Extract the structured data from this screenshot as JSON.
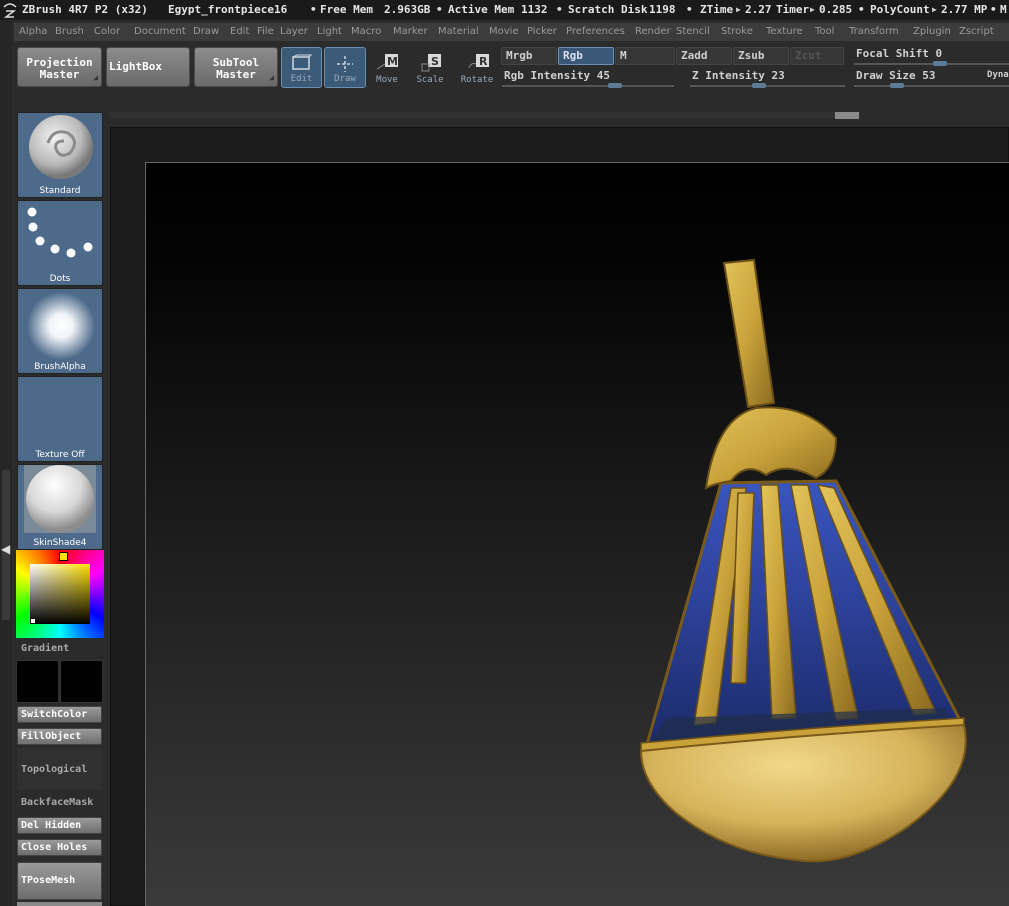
{
  "titlebar": {
    "app": "ZBrush 4R7 P2 (x32)",
    "document": "Egypt_frontpiece16",
    "free_mem_label": "Free Mem",
    "free_mem_value": "2.963GB",
    "active_mem_label": "Active Mem",
    "active_mem_value": "1132",
    "scratch_label": "Scratch Disk",
    "scratch_value": "1198",
    "ztime_label": "ZTime",
    "ztime_value": "2.27",
    "timer_label": "Timer",
    "timer_value": "0.285",
    "polycount_label": "PolyCount",
    "polycount_value": "2.77 MP",
    "trailing": "M"
  },
  "menubar": [
    "Alpha",
    "Brush",
    "Color",
    "Document",
    "Draw",
    "Edit",
    "File",
    "Layer",
    "Light",
    "Macro",
    "Marker",
    "Material",
    "Movie",
    "Picker",
    "Preferences",
    "Render",
    "Stencil",
    "Stroke",
    "Texture",
    "Tool",
    "Transform",
    "Zplugin",
    "Zscript"
  ],
  "toolbar": {
    "projection_master": [
      "Projection",
      "Master"
    ],
    "lightbox": "LightBox",
    "subtool_master": [
      "SubTool",
      "Master"
    ],
    "edit": "Edit",
    "draw": "Draw",
    "move": "Move",
    "scale": "Scale",
    "rotate": "Rotate",
    "mrgb": "Mrgb",
    "rgb": "Rgb",
    "m": "M",
    "zadd": "Zadd",
    "zsub": "Zsub",
    "zcut": "Zcut",
    "rgb_intensity_label": "Rgb Intensity",
    "rgb_intensity_value": "45",
    "z_intensity_label": "Z Intensity",
    "z_intensity_value": "23",
    "focal_shift_label": "Focal Shift",
    "focal_shift_value": "0",
    "draw_size_label": "Draw Size",
    "draw_size_value": "53",
    "dynamic": "Dyna"
  },
  "palette": {
    "brush": "Standard",
    "stroke": "Dots",
    "alpha": "BrushAlpha",
    "texture": "Texture Off",
    "material": "SkinShade4",
    "gradient": "Gradient",
    "switch_color": "SwitchColor",
    "fill_object": "FillObject",
    "topological": "Topological",
    "backface_mask": "BackfaceMask",
    "del_hidden": "Del Hidden",
    "close_holes": "Close Holes",
    "tpose_mesh": "TPoseMesh"
  },
  "colors": {
    "accent_blue": "#3b5a78",
    "thumb_bg": "#4d6a8a",
    "gold": "#c9a23a",
    "lapis": "#2a3f9e"
  }
}
